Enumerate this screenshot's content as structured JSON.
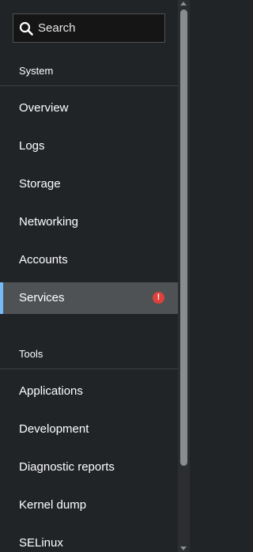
{
  "search": {
    "placeholder": "Search",
    "icon": "search-icon"
  },
  "groups": [
    {
      "title": "System",
      "items": [
        {
          "label": "Overview"
        },
        {
          "label": "Logs"
        },
        {
          "label": "Storage"
        },
        {
          "label": "Networking"
        },
        {
          "label": "Accounts"
        },
        {
          "label": "Services",
          "active": true,
          "badge_icon": "alert-icon"
        }
      ]
    },
    {
      "title": "Tools",
      "items": [
        {
          "label": "Applications"
        },
        {
          "label": "Development"
        },
        {
          "label": "Diagnostic reports"
        },
        {
          "label": "Kernel dump"
        },
        {
          "label": "SELinux"
        }
      ]
    }
  ],
  "colors": {
    "background": "#212427",
    "active_item": "#4f5255",
    "active_marker": "#73bcf7",
    "alert": "#e0413a"
  }
}
